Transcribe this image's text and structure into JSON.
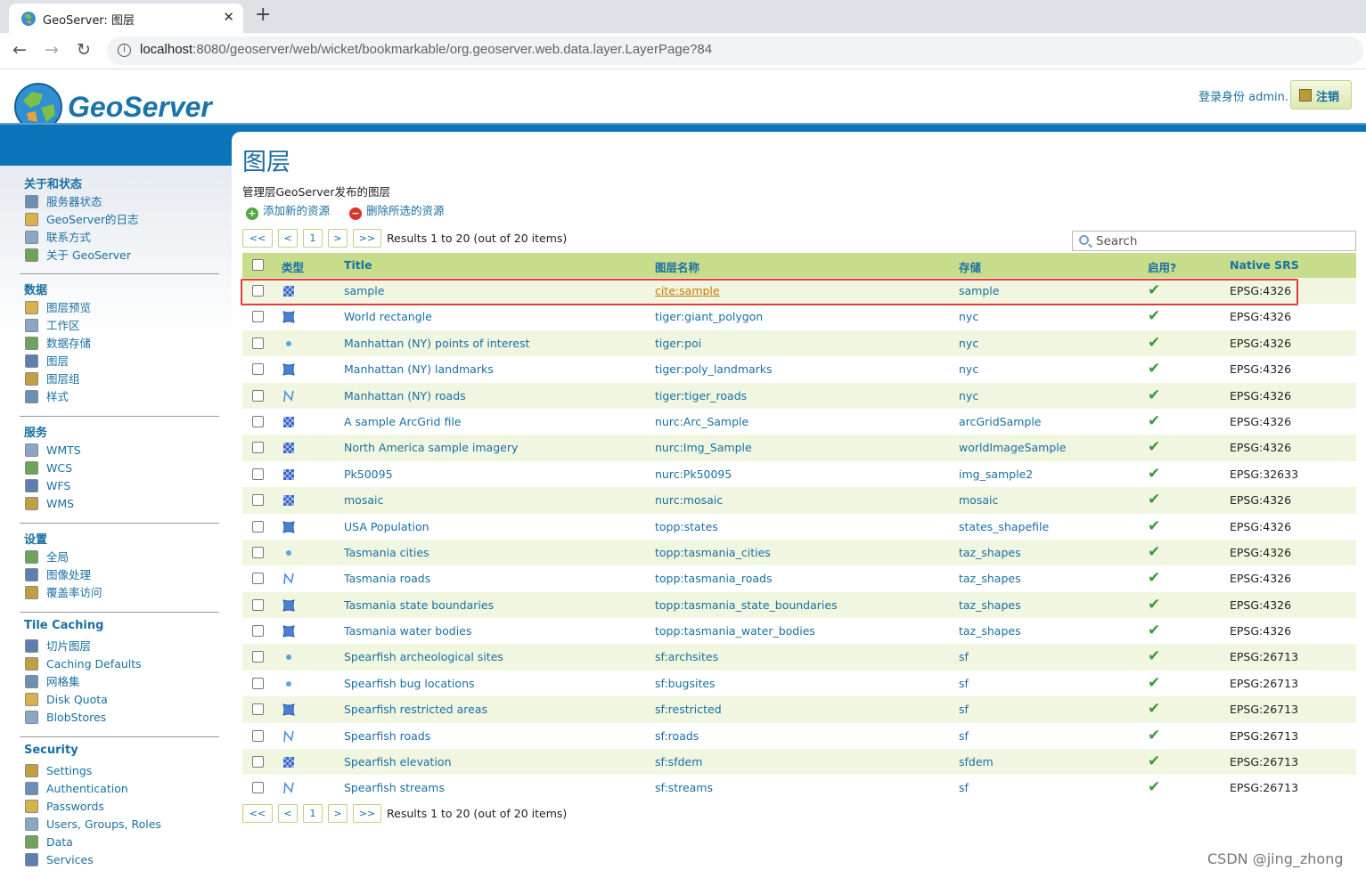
{
  "browser": {
    "tab_title": "GeoServer: 图层",
    "tab_close": "✕",
    "new_tab": "+",
    "url_host": "localhost",
    "url_rest": ":8080/geoserver/web/wicket/bookmarkable/org.geoserver.web.data.layer.LayerPage?84",
    "back": "←",
    "forward": "→",
    "reload": "↻"
  },
  "header": {
    "logo_text": "GeoServer",
    "login_text": "登录身份 admin.",
    "logout_label": "注销"
  },
  "sidebar": {
    "sections": [
      {
        "title": "关于和状态",
        "items": [
          "服务器状态",
          "GeoServer的日志",
          "联系方式",
          "关于 GeoServer"
        ]
      },
      {
        "title": "数据",
        "items": [
          "图层预览",
          "工作区",
          "数据存储",
          "图层",
          "图层组",
          "样式"
        ]
      },
      {
        "title": "服务",
        "items": [
          "WMTS",
          "WCS",
          "WFS",
          "WMS"
        ]
      },
      {
        "title": "设置",
        "items": [
          "全局",
          "图像处理",
          "覆盖率访问"
        ]
      },
      {
        "title": "Tile Caching",
        "items": [
          "切片图层",
          "Caching Defaults",
          "网格集",
          "Disk Quota",
          "BlobStores"
        ]
      },
      {
        "title": "Security",
        "items": [
          "Settings",
          "Authentication",
          "Passwords",
          "Users, Groups, Roles",
          "Data",
          "Services"
        ]
      }
    ]
  },
  "main": {
    "title": "图层",
    "description": "管理层GeoServer发布的图层",
    "add_label": "添加新的资源",
    "delete_label": "删除所选的资源",
    "pager": {
      "first": "<<",
      "prev": "<",
      "page": "1",
      "next": ">",
      "last": ">>",
      "info": "Results 1 to 20 (out of 20 items)"
    },
    "search_placeholder": "Search",
    "columns": [
      "类型",
      "Title",
      "图层名称",
      "存储",
      "启用?",
      "Native SRS"
    ],
    "rows": [
      {
        "type": "raster",
        "title": "sample",
        "name": "cite:sample",
        "store": "sample",
        "enabled": "✔",
        "srs": "EPSG:4326"
      },
      {
        "type": "polygon",
        "title": "World rectangle",
        "name": "tiger:giant_polygon",
        "store": "nyc",
        "enabled": "✔",
        "srs": "EPSG:4326"
      },
      {
        "type": "point",
        "title": "Manhattan (NY) points of interest",
        "name": "tiger:poi",
        "store": "nyc",
        "enabled": "✔",
        "srs": "EPSG:4326"
      },
      {
        "type": "polygon",
        "title": "Manhattan (NY) landmarks",
        "name": "tiger:poly_landmarks",
        "store": "nyc",
        "enabled": "✔",
        "srs": "EPSG:4326"
      },
      {
        "type": "line",
        "title": "Manhattan (NY) roads",
        "name": "tiger:tiger_roads",
        "store": "nyc",
        "enabled": "✔",
        "srs": "EPSG:4326"
      },
      {
        "type": "raster",
        "title": "A sample ArcGrid file",
        "name": "nurc:Arc_Sample",
        "store": "arcGridSample",
        "enabled": "✔",
        "srs": "EPSG:4326"
      },
      {
        "type": "raster",
        "title": "North America sample imagery",
        "name": "nurc:Img_Sample",
        "store": "worldImageSample",
        "enabled": "✔",
        "srs": "EPSG:4326"
      },
      {
        "type": "raster",
        "title": "Pk50095",
        "name": "nurc:Pk50095",
        "store": "img_sample2",
        "enabled": "✔",
        "srs": "EPSG:32633"
      },
      {
        "type": "raster",
        "title": "mosaic",
        "name": "nurc:mosaic",
        "store": "mosaic",
        "enabled": "✔",
        "srs": "EPSG:4326"
      },
      {
        "type": "polygon",
        "title": "USA Population",
        "name": "topp:states",
        "store": "states_shapefile",
        "enabled": "✔",
        "srs": "EPSG:4326"
      },
      {
        "type": "point",
        "title": "Tasmania cities",
        "name": "topp:tasmania_cities",
        "store": "taz_shapes",
        "enabled": "✔",
        "srs": "EPSG:4326"
      },
      {
        "type": "line",
        "title": "Tasmania roads",
        "name": "topp:tasmania_roads",
        "store": "taz_shapes",
        "enabled": "✔",
        "srs": "EPSG:4326"
      },
      {
        "type": "polygon",
        "title": "Tasmania state boundaries",
        "name": "topp:tasmania_state_boundaries",
        "store": "taz_shapes",
        "enabled": "✔",
        "srs": "EPSG:4326"
      },
      {
        "type": "polygon",
        "title": "Tasmania water bodies",
        "name": "topp:tasmania_water_bodies",
        "store": "taz_shapes",
        "enabled": "✔",
        "srs": "EPSG:4326"
      },
      {
        "type": "point",
        "title": "Spearfish archeological sites",
        "name": "sf:archsites",
        "store": "sf",
        "enabled": "✔",
        "srs": "EPSG:26713"
      },
      {
        "type": "point",
        "title": "Spearfish bug locations",
        "name": "sf:bugsites",
        "store": "sf",
        "enabled": "✔",
        "srs": "EPSG:26713"
      },
      {
        "type": "polygon",
        "title": "Spearfish restricted areas",
        "name": "sf:restricted",
        "store": "sf",
        "enabled": "✔",
        "srs": "EPSG:26713"
      },
      {
        "type": "line",
        "title": "Spearfish roads",
        "name": "sf:roads",
        "store": "sf",
        "enabled": "✔",
        "srs": "EPSG:26713"
      },
      {
        "type": "raster",
        "title": "Spearfish elevation",
        "name": "sf:sfdem",
        "store": "sfdem",
        "enabled": "✔",
        "srs": "EPSG:26713"
      },
      {
        "type": "line",
        "title": "Spearfish streams",
        "name": "sf:streams",
        "store": "sf",
        "enabled": "✔",
        "srs": "EPSG:26713"
      }
    ]
  },
  "watermark": "CSDN @jing_zhong",
  "colors": {
    "header_blue": "#0c74b8",
    "table_header": "#c7dd8c",
    "row_alt": "#f0f6e0",
    "link": "#1a6fa3",
    "highlight": "#e23c3c",
    "visited_link": "#c77a00"
  }
}
